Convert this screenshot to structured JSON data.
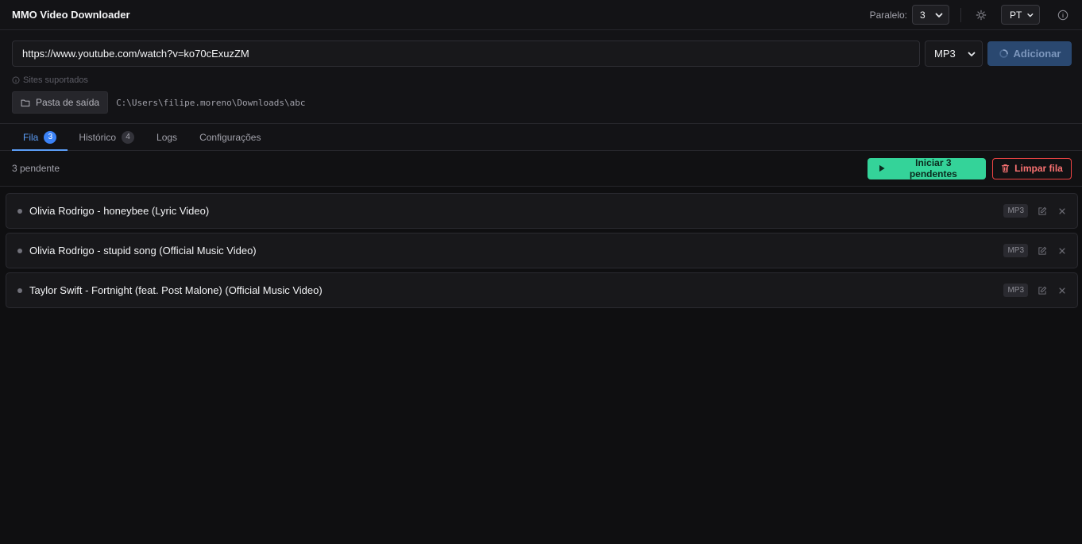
{
  "header": {
    "title": "MMO Video Downloader",
    "parallel_label": "Paralelo:",
    "parallel_value": "3",
    "language_value": "PT"
  },
  "input": {
    "url_value": "https://www.youtube.com/watch?v=ko70cExuzZM",
    "format_value": "MP3",
    "add_label": "Adicionar",
    "supported_label": "Sites suportados",
    "output_button_label": "Pasta de saída",
    "output_path": "C:\\Users\\filipe.moreno\\Downloads\\abc"
  },
  "tabs": [
    {
      "label": "Fila",
      "badge": "3",
      "active": true
    },
    {
      "label": "Histórico",
      "badge": "4",
      "active": false
    },
    {
      "label": "Logs",
      "badge": "",
      "active": false
    },
    {
      "label": "Configurações",
      "badge": "",
      "active": false
    }
  ],
  "queue": {
    "pending_text": "3 pendente",
    "start_label": "Iniciar 3 pendentes",
    "clear_label": "Limpar fila",
    "items": [
      {
        "title": "Olivia Rodrigo - honeybee (Lyric Video)",
        "format": "MP3"
      },
      {
        "title": "Olivia Rodrigo - stupid song (Official Music Video)",
        "format": "MP3"
      },
      {
        "title": "Taylor Swift - Fortnight (feat. Post Malone) (Official Music Video)",
        "format": "MP3"
      }
    ]
  },
  "colors": {
    "accent": "#5b9cf5",
    "start_green": "#34d399",
    "clear_red": "#ef4444",
    "background": "#0f0f11"
  }
}
